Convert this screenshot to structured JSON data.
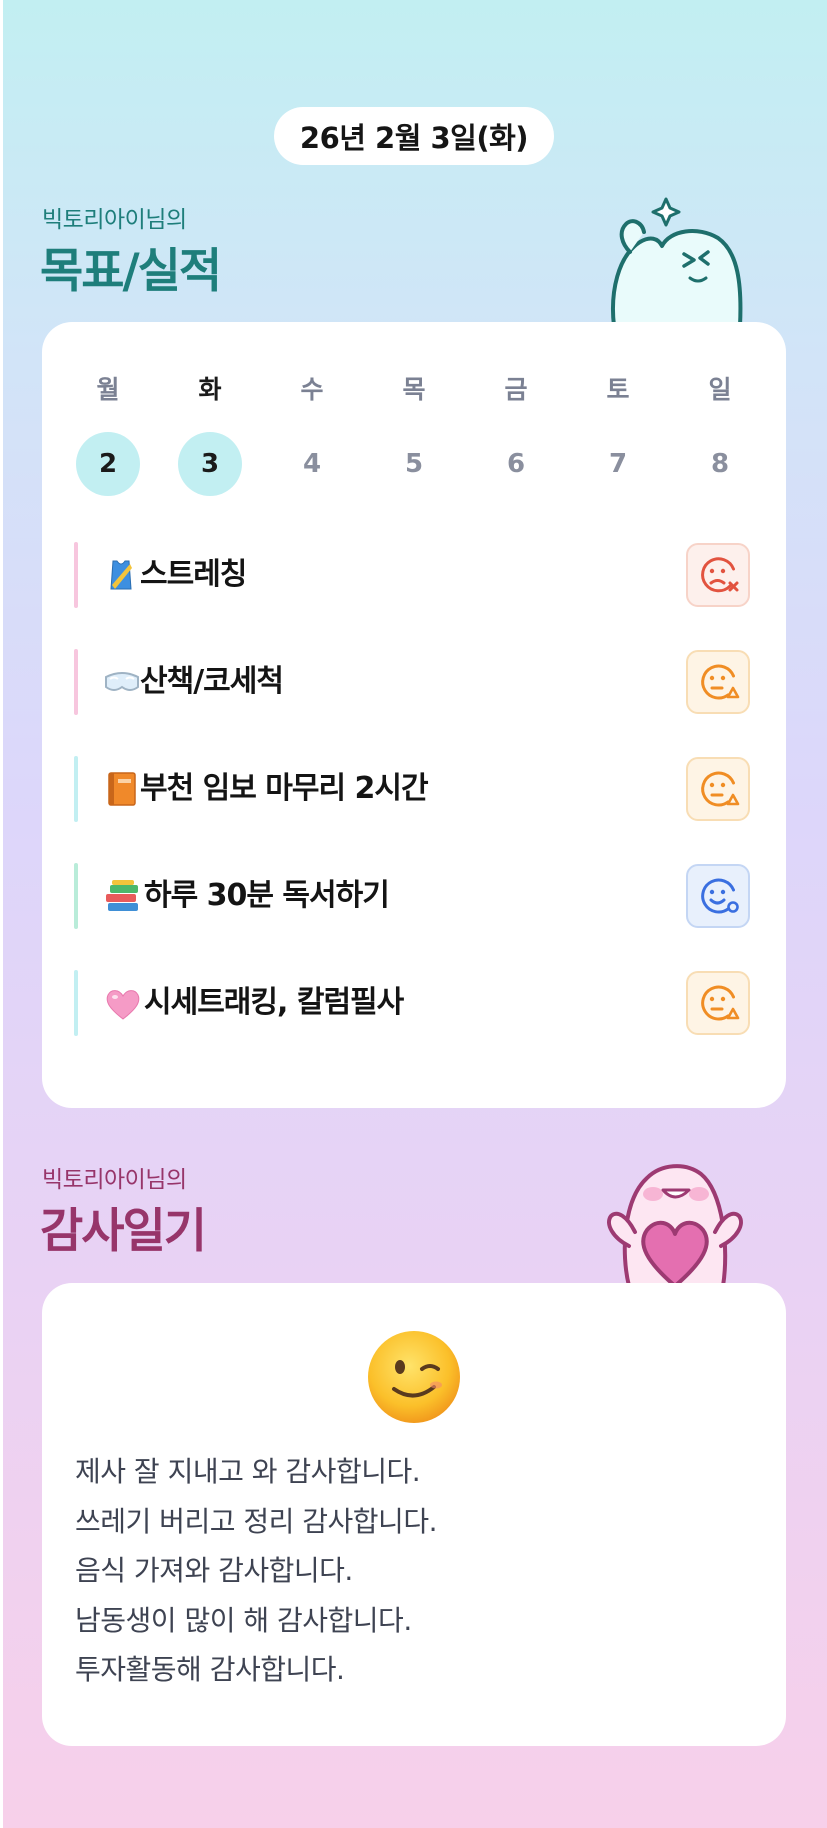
{
  "date": "26년 2월 3일(화)",
  "goals_section": {
    "subtitle": "빅토리아이님의",
    "title": "목표/실적"
  },
  "week": {
    "days": [
      {
        "label": "월",
        "number": "2",
        "done": true
      },
      {
        "label": "화",
        "number": "3",
        "done": true,
        "today": true
      },
      {
        "label": "수",
        "number": "4",
        "done": false
      },
      {
        "label": "목",
        "number": "5",
        "done": false
      },
      {
        "label": "금",
        "number": "6",
        "done": false
      },
      {
        "label": "토",
        "number": "7",
        "done": false
      },
      {
        "label": "일",
        "number": "8",
        "done": false
      }
    ]
  },
  "goals": [
    {
      "icon": "running-shirt-emoji",
      "text": "스트레칭",
      "status": "fail",
      "bar_color": "#f7c6de"
    },
    {
      "icon": "goggles-emoji",
      "text": "산책/코세척",
      "status": "partial",
      "bar_color": "#f7c6de"
    },
    {
      "icon": "orange-book-emoji",
      "text": "부천 임보 마무리 2시간",
      "status": "partial",
      "bar_color": "#c2eff2"
    },
    {
      "icon": "books-emoji",
      "text": " 하루 30분 독서하기",
      "status": "success",
      "bar_color": "#b9ecd9"
    },
    {
      "icon": "pink-heart-emoji",
      "text": " 시세트래킹, 칼럼필사",
      "status": "partial",
      "bar_color": "#c2eff2"
    }
  ],
  "status_icons": {
    "fail": "sad-face-x-icon",
    "partial": "neutral-face-triangle-icon",
    "success": "smile-face-circle-icon"
  },
  "colors": {
    "teal": "#1e7e7b",
    "plum": "#97356a",
    "fail": "#e2533f",
    "partial": "#f08d24",
    "success": "#3a6fe0"
  },
  "thanks_section": {
    "subtitle": "빅토리아이님의",
    "title": "감사일기",
    "mood_icon": "winking-face-emoji",
    "lines": [
      "제사 잘 지내고 와 감사합니다.",
      "쓰레기 버리고 정리 감사합니다.",
      "음식 가져와 감사합니다.",
      "남동생이 많이 해 감사합니다.",
      "투자활동해 감사합니다."
    ]
  }
}
